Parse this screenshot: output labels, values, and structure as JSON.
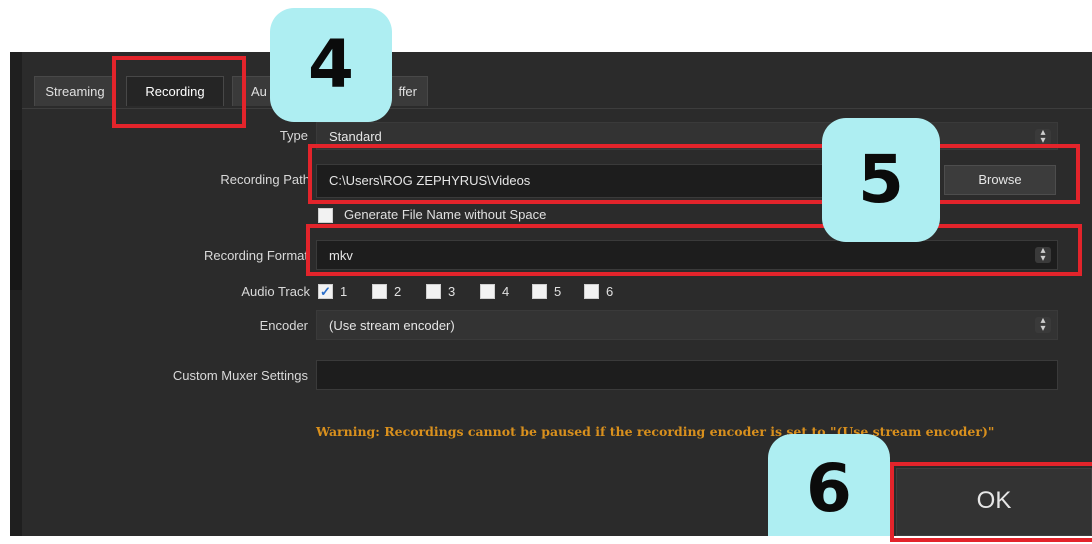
{
  "tabs": [
    {
      "label": "Streaming"
    },
    {
      "label": "Recording"
    },
    {
      "label": "Au"
    },
    {
      "label": "ffer"
    }
  ],
  "form": {
    "type": {
      "label": "Type",
      "value": "Standard"
    },
    "recording_path": {
      "label": "Recording Path",
      "value": "C:\\Users\\ROG ZEPHYRUS\\Videos",
      "browse_label": "Browse"
    },
    "generate_name": {
      "label": "Generate File Name without Space",
      "checked": false
    },
    "recording_format": {
      "label": "Recording Format",
      "value": "mkv"
    },
    "audio_track": {
      "label": "Audio Track",
      "tracks": [
        {
          "label": "1",
          "checked": true
        },
        {
          "label": "2",
          "checked": false
        },
        {
          "label": "3",
          "checked": false
        },
        {
          "label": "4",
          "checked": false
        },
        {
          "label": "5",
          "checked": false
        },
        {
          "label": "6",
          "checked": false
        }
      ]
    },
    "encoder": {
      "label": "Encoder",
      "value": "(Use stream encoder)"
    },
    "custom_muxer": {
      "label": "Custom Muxer Settings",
      "value": ""
    }
  },
  "warning": "Warning: Recordings cannot be paused if the recording encoder is set to \"(Use stream encoder)\"",
  "ok_label": "OK",
  "steps": {
    "step4": "4",
    "step5": "5",
    "step6": "6"
  },
  "icons": {
    "spinner": "updown-arrows-icon",
    "check": "checkmark-icon"
  },
  "colors": {
    "highlight_box": "#e3242b",
    "step_badge": "#aeeef2",
    "warning_text": "#d9901d"
  }
}
